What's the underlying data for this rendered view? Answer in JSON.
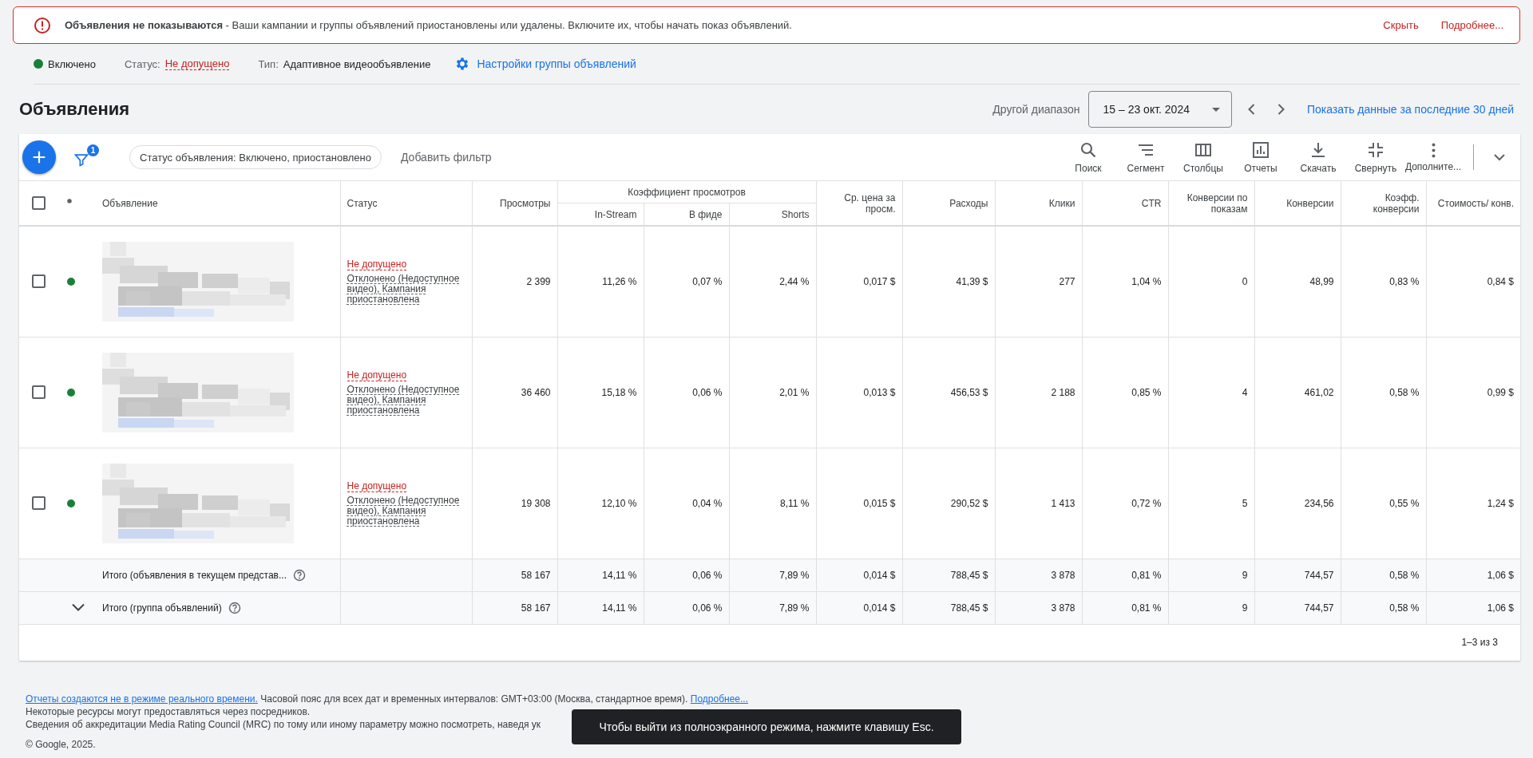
{
  "banner": {
    "message": "**Объявления не показываются** - Ваши кампании и группы объявлений приостановлены или удалены. Включите их, чтобы начать показ объявлений.",
    "actions": [
      {
        "label": "Скрыть"
      },
      {
        "label": "Подробнее..."
      }
    ]
  },
  "summary": {
    "state": "Включено",
    "status_label": "Статус:",
    "status_value": "Не допущено",
    "type_label": "Тип:",
    "type_value": "Адаптивное видеообъявление",
    "settings_link": "Настройки группы объявлений"
  },
  "header": {
    "title": "Объявления",
    "range_label": "Другой диапазон",
    "date_range": "15 – 23 окт. 2024",
    "show_30_days": "Показать данные за последние 30 дней"
  },
  "toolbar": {
    "filter_count": "1",
    "filter_chip": "Статус объявления: Включено, приостановлено",
    "add_filter": "Добавить фильтр",
    "actions": [
      {
        "kind": "search",
        "label": "Поиск"
      },
      {
        "kind": "segment",
        "label": "Сегмент"
      },
      {
        "kind": "columns",
        "label": "Столбцы"
      },
      {
        "kind": "reports",
        "label": "Отчеты"
      },
      {
        "kind": "download",
        "label": "Скачать"
      },
      {
        "kind": "collapse",
        "label": "Свернуть"
      },
      {
        "kind": "more",
        "label": "Дополните..."
      }
    ]
  },
  "table": {
    "select_all_checked": false,
    "fixed_columns": [
      {
        "label": "Объявление"
      },
      {
        "label": "Статус"
      }
    ],
    "column_group": "Коэффициент просмотров",
    "columns": [
      {
        "label": "Просмотры",
        "grouped": false
      },
      {
        "label": "In-Stream",
        "grouped": true
      },
      {
        "label": "В фиде",
        "grouped": true
      },
      {
        "label": "Shorts",
        "grouped": true
      },
      {
        "label": "Ср. цена за просм.",
        "grouped": false
      },
      {
        "label": "Расходы",
        "grouped": false
      },
      {
        "label": "Клики",
        "grouped": false
      },
      {
        "label": "CTR",
        "grouped": false
      },
      {
        "label": "Конверсии по показам",
        "grouped": false
      },
      {
        "label": "Конверсии",
        "grouped": false
      },
      {
        "label": "Коэфф. конверсии",
        "grouped": false
      },
      {
        "label": "Стоимость/ конв.",
        "grouped": false
      }
    ],
    "rows": [
      {
        "checked": false,
        "color": "#188038",
        "status": "Не допущено",
        "status_detail": "Отклонено (Недоступное видео), Кампания приостановлена",
        "cells": [
          "2 399",
          "11,26 %",
          "0,07 %",
          "2,44 %",
          "0,017 $",
          "41,39 $",
          "277",
          "1,04 %",
          "0",
          "48,99",
          "0,83 %",
          "0,84 $"
        ]
      },
      {
        "checked": false,
        "color": "#188038",
        "status": "Не допущено",
        "status_detail": "Отклонено (Недоступное видео), Кампания приостановлена",
        "cells": [
          "36 460",
          "15,18 %",
          "0,06 %",
          "2,01 %",
          "0,013 $",
          "456,53 $",
          "2 188",
          "0,85 %",
          "4",
          "461,02",
          "0,58 %",
          "0,99 $"
        ]
      },
      {
        "checked": false,
        "color": "#188038",
        "status": "Не допущено",
        "status_detail": "Отклонено (Недоступное видео), Кампания приостановлена",
        "cells": [
          "19 308",
          "12,10 %",
          "0,04 %",
          "8,11 %",
          "0,015 $",
          "290,52 $",
          "1 413",
          "0,72 %",
          "5",
          "234,56",
          "0,55 %",
          "1,24 $"
        ]
      }
    ],
    "totals": [
      {
        "expandable": false,
        "label": "Итого (объявления в текущем представ...",
        "cells": [
          "58 167",
          "14,11 %",
          "0,06 %",
          "7,89 %",
          "0,014 $",
          "788,45 $",
          "3 878",
          "0,81 %",
          "9",
          "744,57",
          "0,58 %",
          "1,06 $"
        ]
      },
      {
        "expandable": true,
        "label": "Итого (группа объявлений)",
        "cells": [
          "58 167",
          "14,11 %",
          "0,06 %",
          "7,89 %",
          "0,014 $",
          "788,45 $",
          "3 878",
          "0,81 %",
          "9",
          "744,57",
          "0,58 %",
          "1,06 $"
        ]
      }
    ],
    "pagination": "1–3 из 3"
  },
  "footer": {
    "link": "Отчеты создаются не в режиме реального времени.",
    "text": "Часовой пояс для всех дат и временных интервалов: GMT+03:00 (Москва, стандартное время).",
    "more_link": "Подробнее...",
    "line2": "Некоторые ресурсы могут предоставляться через посредников.",
    "line3": "Сведения об аккредитации Media Rating Council (MRC) по тому или иному параметру можно посмотреть, наведя ук",
    "copyright": "© Google, 2025."
  },
  "toast": "Чтобы выйти из полноэкранного режима, нажмите клавишу Esc."
}
